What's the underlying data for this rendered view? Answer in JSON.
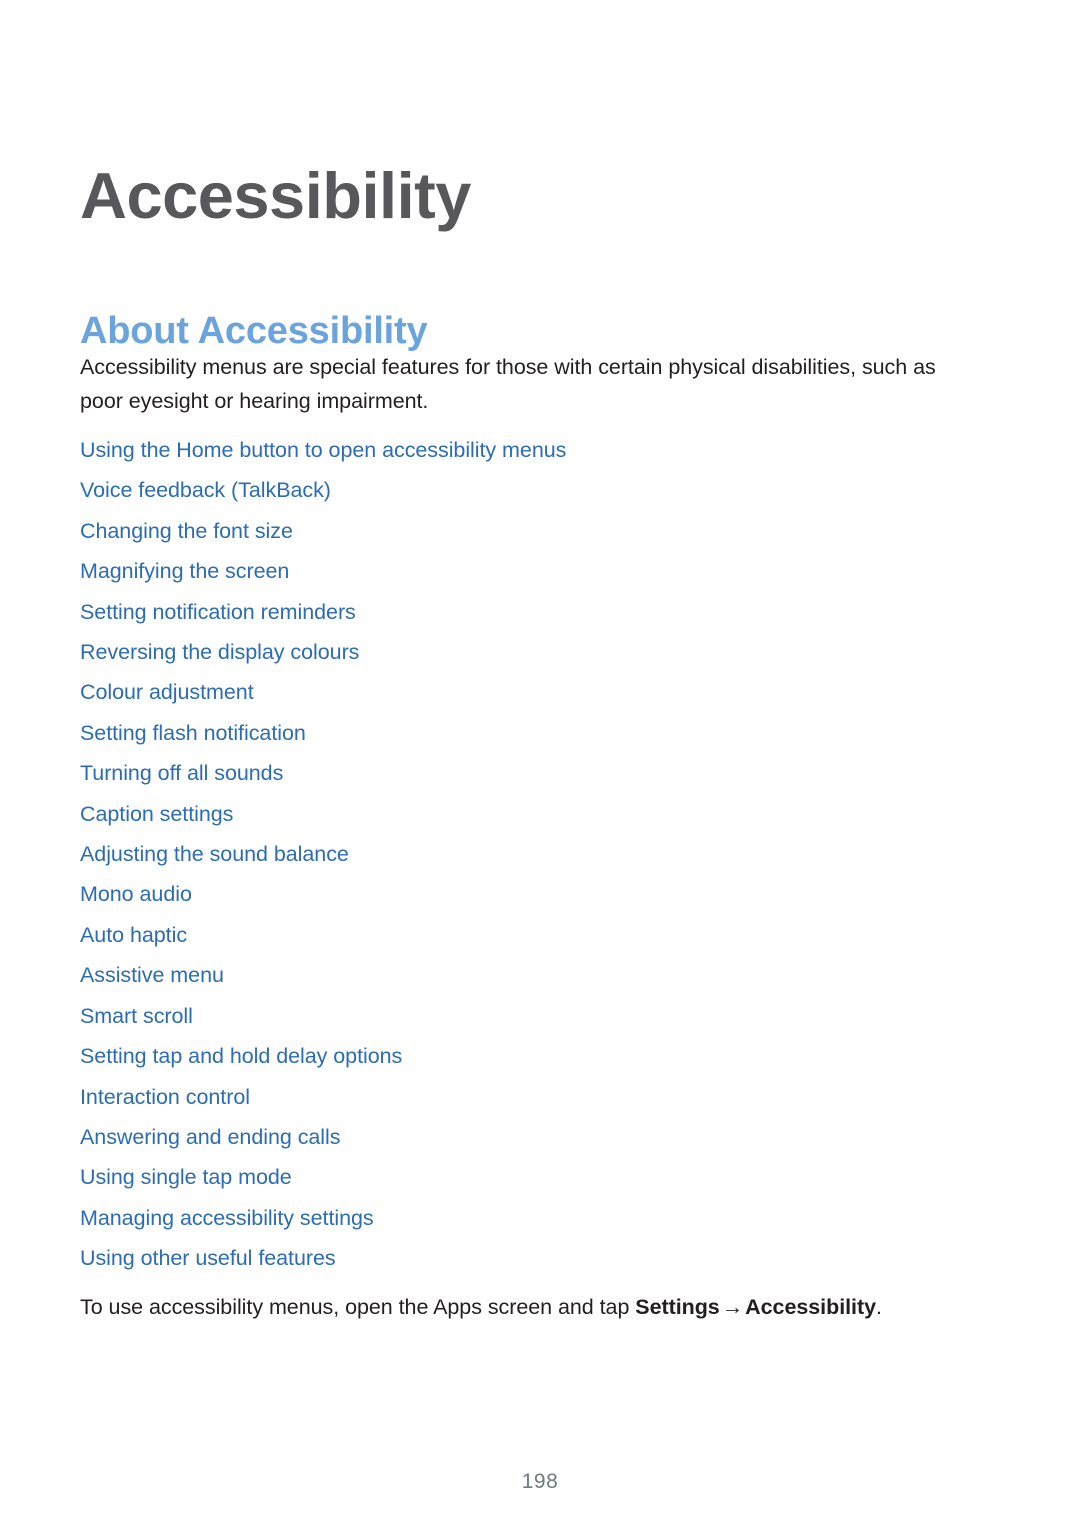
{
  "document": {
    "chapter_title": "Accessibility",
    "section_heading": "About Accessibility",
    "intro_paragraph": "Accessibility menus are special features for those with certain physical disabilities, such as poor eyesight or hearing impairment.",
    "closing": {
      "lead_text": "To use accessibility menus, open the Apps screen and tap ",
      "setting_primary": "Settings",
      "arrow": "→",
      "setting_secondary": "Accessibility",
      "trailing_text": "."
    },
    "page_number": "198"
  },
  "toc": {
    "links": [
      {
        "label": "Using the Home button to open accessibility menus"
      },
      {
        "label": "Voice feedback (TalkBack)"
      },
      {
        "label": "Changing the font size"
      },
      {
        "label": "Magnifying the screen"
      },
      {
        "label": "Setting notification reminders"
      },
      {
        "label": "Reversing the display colours"
      },
      {
        "label": "Colour adjustment"
      },
      {
        "label": "Setting flash notification"
      },
      {
        "label": "Turning off all sounds"
      },
      {
        "label": "Caption settings"
      },
      {
        "label": "Adjusting the sound balance"
      },
      {
        "label": "Mono audio"
      },
      {
        "label": "Auto haptic"
      },
      {
        "label": "Assistive menu"
      },
      {
        "label": "Smart scroll"
      },
      {
        "label": "Setting tap and hold delay options"
      },
      {
        "label": "Interaction control"
      },
      {
        "label": "Answering and ending calls"
      },
      {
        "label": "Using single tap mode"
      },
      {
        "label": "Managing accessibility settings"
      },
      {
        "label": "Using other useful features"
      }
    ]
  },
  "colors": {
    "chapter_title": "#58585B",
    "section_heading": "#6BA3DC",
    "link": "#2C6CB5",
    "body_text": "#231F20",
    "page_number": "#6E7B80",
    "background": "#FFFFFF"
  }
}
